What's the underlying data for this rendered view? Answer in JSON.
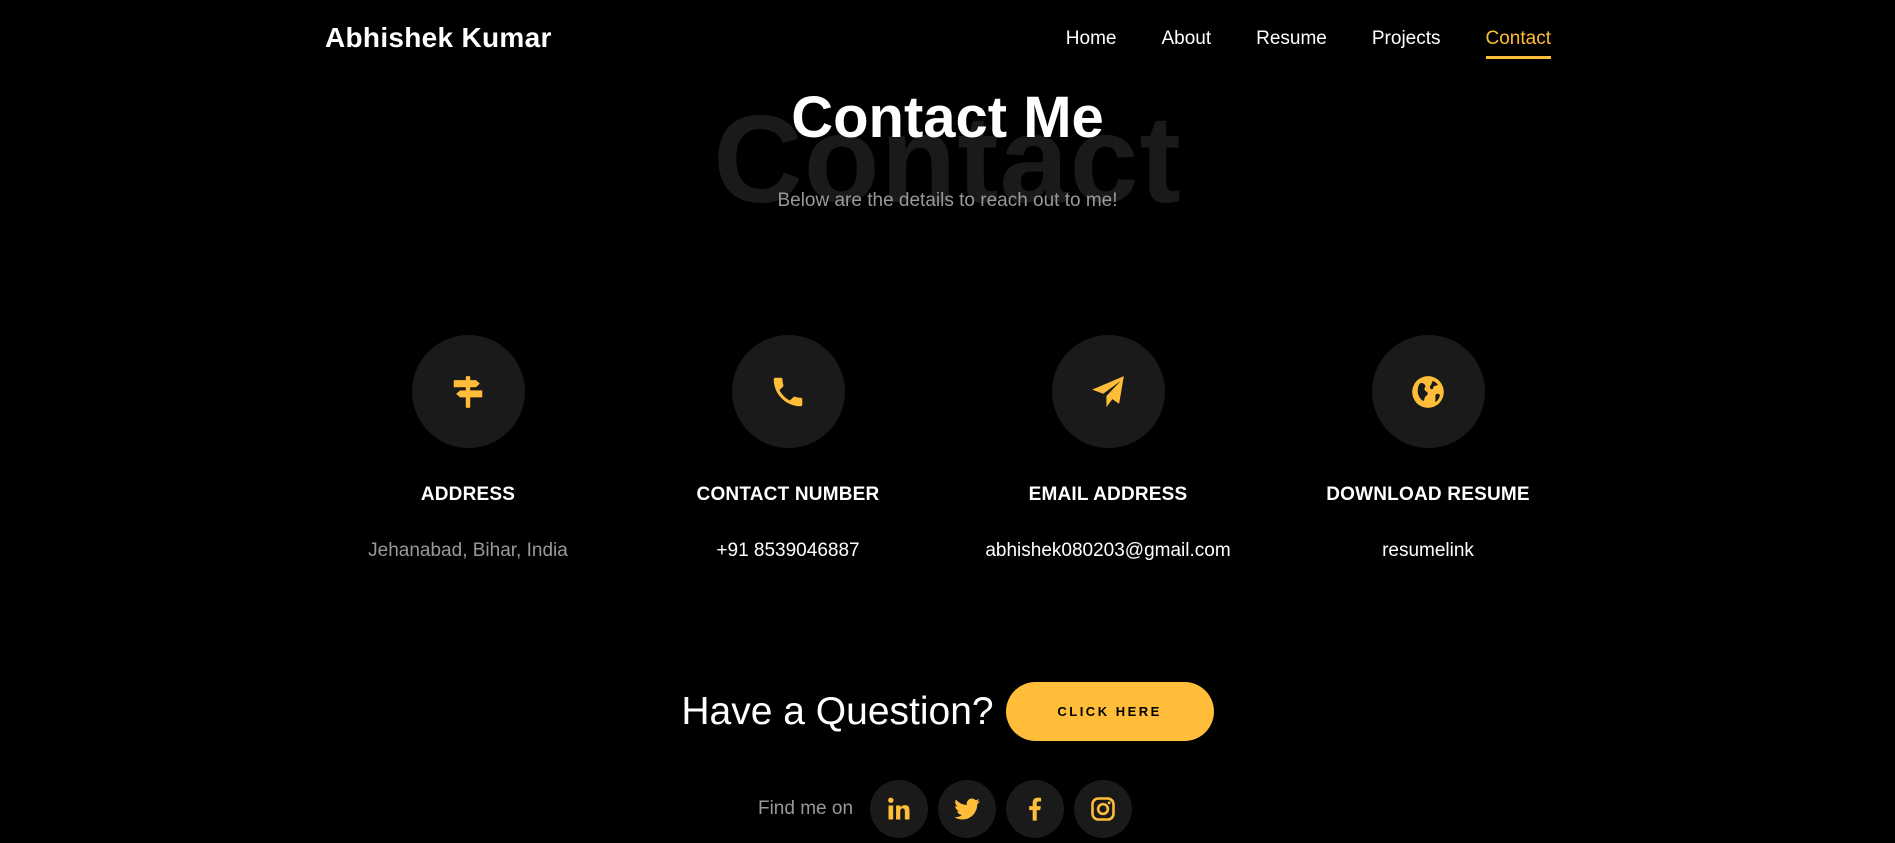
{
  "brand": "Abhishek Kumar",
  "nav": [
    {
      "label": "Home"
    },
    {
      "label": "About"
    },
    {
      "label": "Resume"
    },
    {
      "label": "Projects"
    },
    {
      "label": "Contact",
      "active": true
    }
  ],
  "section": {
    "background_word": "Contact",
    "heading": "Contact Me",
    "subtitle": "Below are the details to reach out to me!"
  },
  "cards": [
    {
      "icon": "signpost-icon",
      "title": "ADDRESS",
      "value": "Jehanabad, Bihar, India"
    },
    {
      "icon": "phone-icon",
      "title": "CONTACT NUMBER",
      "value": "+91 8539046887"
    },
    {
      "icon": "paper-plane-icon",
      "title": "EMAIL ADDRESS",
      "value": "abhishek080203@gmail.com"
    },
    {
      "icon": "globe-icon",
      "title": "DOWNLOAD RESUME",
      "value": "resumelink"
    }
  ],
  "question": {
    "text": "Have a Question?",
    "button_label": "CLICK HERE"
  },
  "social": {
    "label": "Find me on",
    "icons": [
      "linkedin-icon",
      "twitter-icon",
      "facebook-icon",
      "instagram-icon"
    ]
  },
  "colors": {
    "accent": "#ffbd39",
    "background": "#000000",
    "circle": "#1a1a1a",
    "muted_text": "#999999"
  }
}
